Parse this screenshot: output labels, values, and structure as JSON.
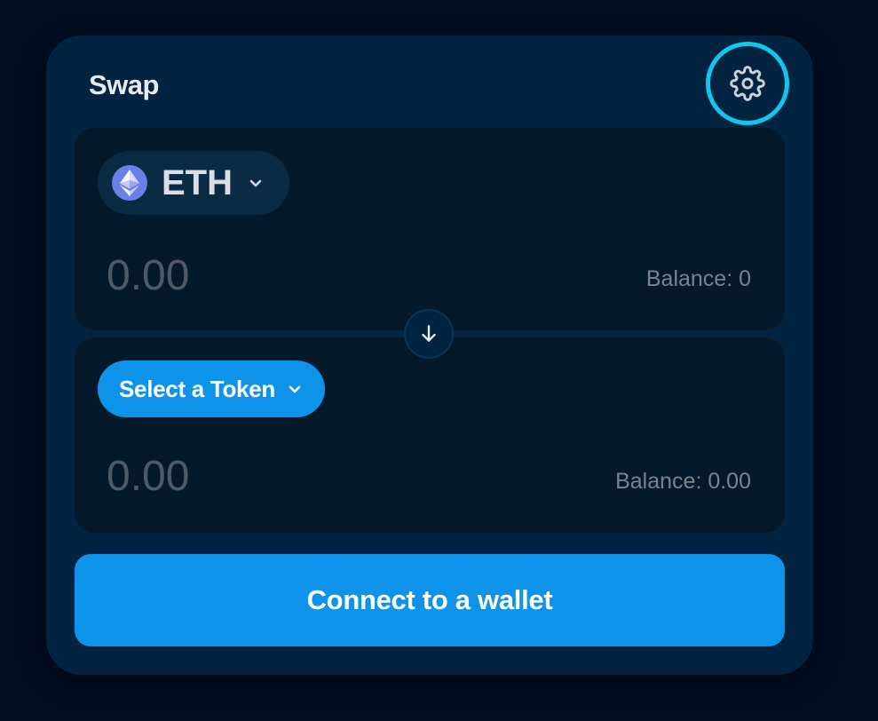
{
  "swap": {
    "title": "Swap",
    "settings_icon": "gear-icon",
    "from": {
      "token_symbol": "ETH",
      "token_icon": "ethereum-icon",
      "amount_placeholder": "0.00",
      "balance": "Balance: 0"
    },
    "switch_icon": "arrow-down-icon",
    "to": {
      "select_label": "Select a Token",
      "amount_placeholder": "0.00",
      "balance": "Balance: 0.00"
    },
    "connect_label": "Connect to a wallet"
  },
  "colors": {
    "background": "#020d22",
    "card": "#032440",
    "panel": "#041a2b",
    "accent": "#0d93ea",
    "focus_ring": "#0fc6ee"
  }
}
